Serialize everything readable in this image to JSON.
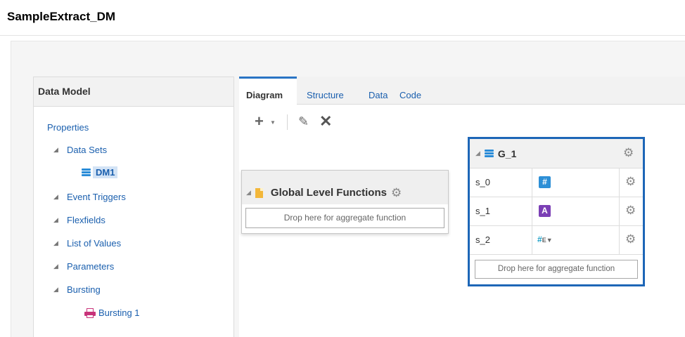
{
  "page": {
    "title": "SampleExtract_DM"
  },
  "data_model_panel": {
    "header": "Data Model",
    "tree": {
      "properties": "Properties",
      "data_sets": "Data Sets",
      "dm1": "DM1",
      "event_triggers": "Event Triggers",
      "flexfields": "Flexfields",
      "list_of_values": "List of Values",
      "parameters": "Parameters",
      "bursting": "Bursting",
      "bursting_1": "Bursting 1"
    }
  },
  "tabs": [
    {
      "label": "Diagram",
      "active": true
    },
    {
      "label": "Structure",
      "active": false
    },
    {
      "label": "Data",
      "active": false
    },
    {
      "label": "Code",
      "active": false
    }
  ],
  "toolbar": {
    "add_icon": "plus-icon",
    "edit_icon": "pencil-icon",
    "delete_icon": "x-icon"
  },
  "global_functions": {
    "title": "Global Level Functions",
    "drop_text": "Drop here for aggregate function"
  },
  "group": {
    "title": "G_1",
    "drop_text": "Drop here for aggregate function",
    "fields": [
      {
        "name": "s_0",
        "type": "number",
        "type_glyph": "#"
      },
      {
        "name": "s_1",
        "type": "text",
        "type_glyph": "A"
      },
      {
        "name": "s_2",
        "type": "number-expression",
        "type_glyph": "#"
      }
    ]
  },
  "colors": {
    "link": "#1a5fae",
    "group_border": "#1d66b7",
    "number_type": "#2d8fd6",
    "text_type": "#7b3fb5",
    "data_set_icon": "#2a8cd8",
    "bursting_icon": "#c8337a",
    "doc_icon": "#f3b73a"
  }
}
